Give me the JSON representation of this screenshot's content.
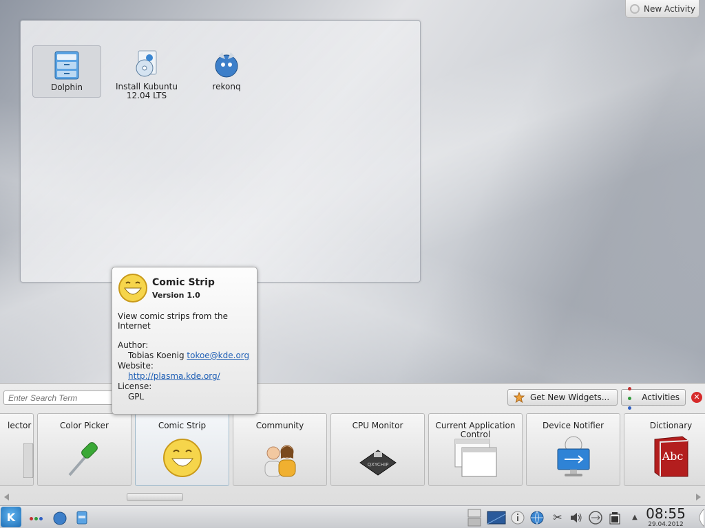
{
  "desktop": {
    "new_activity_label": "New Activity",
    "icons": [
      {
        "label": "Dolphin",
        "icon": "folder-manager-icon",
        "selected": true
      },
      {
        "label": "Install Kubuntu 12.04 LTS",
        "icon": "installer-disc-icon",
        "selected": false
      },
      {
        "label": "rekonq",
        "icon": "browser-icon",
        "selected": false
      }
    ]
  },
  "tooltip": {
    "title": "Comic Strip",
    "version": "Version 1.0",
    "description": "View comic strips from the Internet",
    "author_label": "Author:",
    "author_name": "Tobias Koenig",
    "author_email": "tokoe@kde.org",
    "website_label": "Website:",
    "website_url": "http://plasma.kde.org/",
    "license_label": "License:",
    "license_value": "GPL",
    "icon": "smiley-icon"
  },
  "explorer": {
    "search_placeholder": "Enter Search Term",
    "get_widgets_label": "Get New Widgets...",
    "activities_label": "Activities",
    "close_glyph": "✕",
    "widgets": [
      {
        "label": "lector",
        "icon": "activity-selector-icon"
      },
      {
        "label": "Color Picker",
        "icon": "pipette-icon"
      },
      {
        "label": "Comic Strip",
        "icon": "smiley-icon",
        "hovered": true
      },
      {
        "label": "Community",
        "icon": "people-icon"
      },
      {
        "label": "CPU Monitor",
        "icon": "cpu-chip-icon"
      },
      {
        "label": "Current Application Control",
        "icon": "windows-icon"
      },
      {
        "label": "Device Notifier",
        "icon": "usb-monitor-icon"
      },
      {
        "label": "Dictionary",
        "icon": "dictionary-book-icon"
      }
    ],
    "cpu_chip_text": "QXYCHIP",
    "dictionary_text": "Abc"
  },
  "taskbar": {
    "time": "08:55",
    "date": "29.04.2012",
    "colors": {
      "accent": "#1f6fb6",
      "close": "#d62a2a"
    }
  }
}
